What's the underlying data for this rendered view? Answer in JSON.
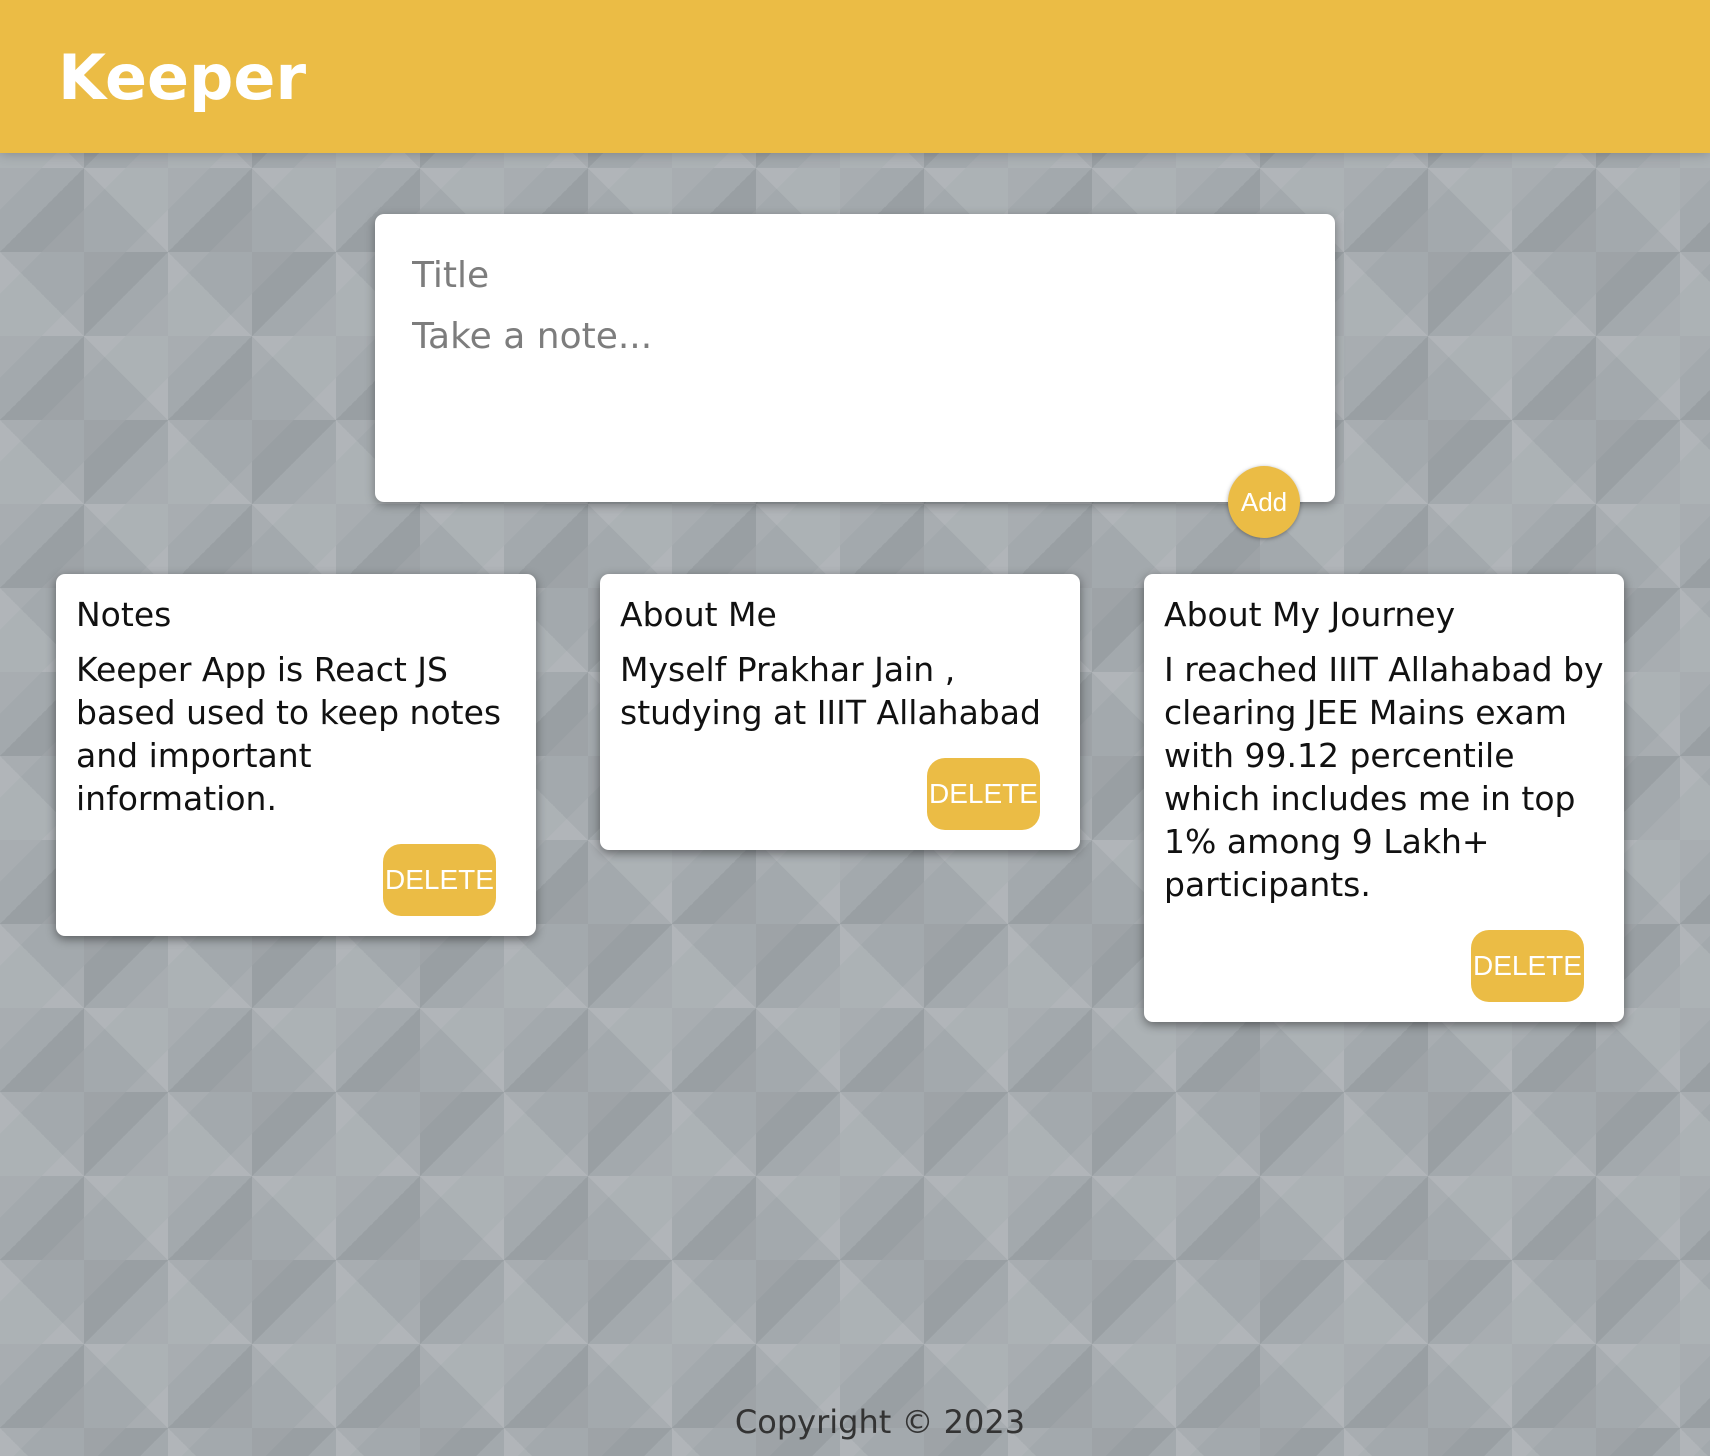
{
  "header": {
    "brand": "Keeper"
  },
  "create_note": {
    "title_placeholder": "Title",
    "content_placeholder": "Take a note...",
    "add_label": "Add"
  },
  "notes": [
    {
      "title": "Notes",
      "content": "Keeper App is React JS based used to keep notes and important information.",
      "delete_label": "DELETE"
    },
    {
      "title": "About Me",
      "content": "Myself Prakhar Jain , studying at IIIT Allahabad",
      "delete_label": "DELETE"
    },
    {
      "title": "About My Journey",
      "content": "I reached IIIT Allahabad by clearing JEE Mains exam with 99.12 percentile which includes me in top 1% among 9 Lakh+ participants.",
      "delete_label": "DELETE"
    }
  ],
  "footer": {
    "copyright": "Copyright © 2023"
  },
  "colors": {
    "accent": "#ebbc45",
    "background": "#a3a9ad",
    "card": "#ffffff"
  }
}
